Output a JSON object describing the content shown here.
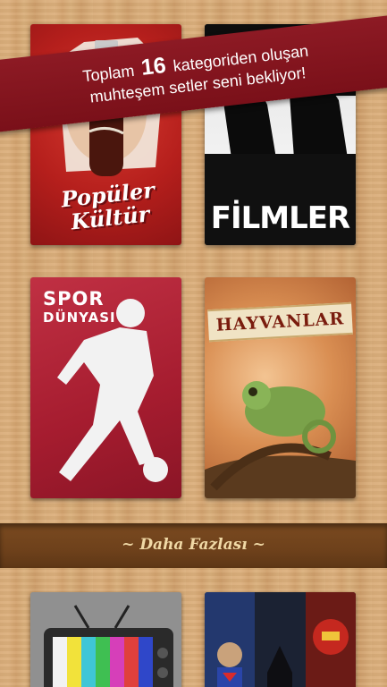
{
  "banner": {
    "line1_prefix": "Toplam",
    "line1_number": "16",
    "line1_suffix": "kategoriden oluşan",
    "line2": "muhteşem setler seni bekliyor!"
  },
  "categories": [
    {
      "line1": "Popüler",
      "line2": "Kültür"
    },
    {
      "title": "FİLMLER"
    },
    {
      "line1": "SPOR",
      "line2": "DÜNYASI"
    },
    {
      "title": "HAYVANLAR"
    }
  ],
  "more_label": "~ Daha Fazlası ~",
  "colors": {
    "banner": "#7a1019",
    "wood": "#d9ac79",
    "more_band": "#6e411b"
  }
}
